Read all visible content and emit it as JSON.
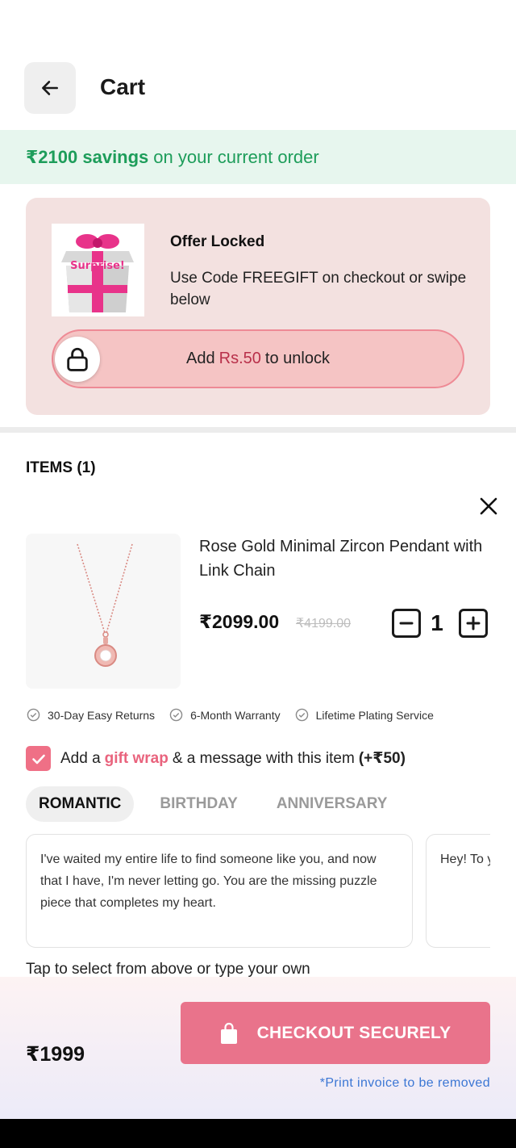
{
  "header": {
    "title": "Cart"
  },
  "savings": {
    "amount": "₹2100 savings",
    "rest": "on your current order"
  },
  "offer": {
    "image_label": "Surprise!",
    "title": "Offer Locked",
    "description": "Use Code FREEGIFT on checkout or swipe below",
    "unlock_prefix": "Add",
    "unlock_amount": "Rs.50",
    "unlock_suffix": "to unlock"
  },
  "items": {
    "heading": "ITEMS (1)",
    "list": [
      {
        "name": "Rose Gold Minimal Zircon Pendant with Link Chain",
        "price": "₹2099.00",
        "mrp": "₹4199.00",
        "quantity": "1"
      }
    ]
  },
  "features": [
    "30-Day Easy Returns",
    "6-Month Warranty",
    "Lifetime Plating Service"
  ],
  "gift": {
    "prefix": "Add a",
    "highlight": "gift wrap",
    "middle": "& a message with this item",
    "price": "(+₹50)",
    "checked": true
  },
  "message_tabs": [
    {
      "label": "ROMANTIC",
      "active": true
    },
    {
      "label": "BIRTHDAY",
      "active": false
    },
    {
      "label": "ANNIVERSARY",
      "active": false
    }
  ],
  "messages": [
    "I've waited my entire life to find someone like you, and now that I have, I'm never letting go. You are the missing puzzle piece that completes my heart.",
    "Hey! To you for s I cherish"
  ],
  "hint": "Tap to select from above or type your own",
  "footer": {
    "total": "₹1999",
    "checkout_label": "CHECKOUT SECURELY",
    "note": "*Print invoice to be removed"
  },
  "colors": {
    "accent_pink": "#e9738b",
    "savings_green": "#1d9d5a",
    "offer_bg": "#f3e1e0",
    "link_blue": "#3b76d4"
  }
}
